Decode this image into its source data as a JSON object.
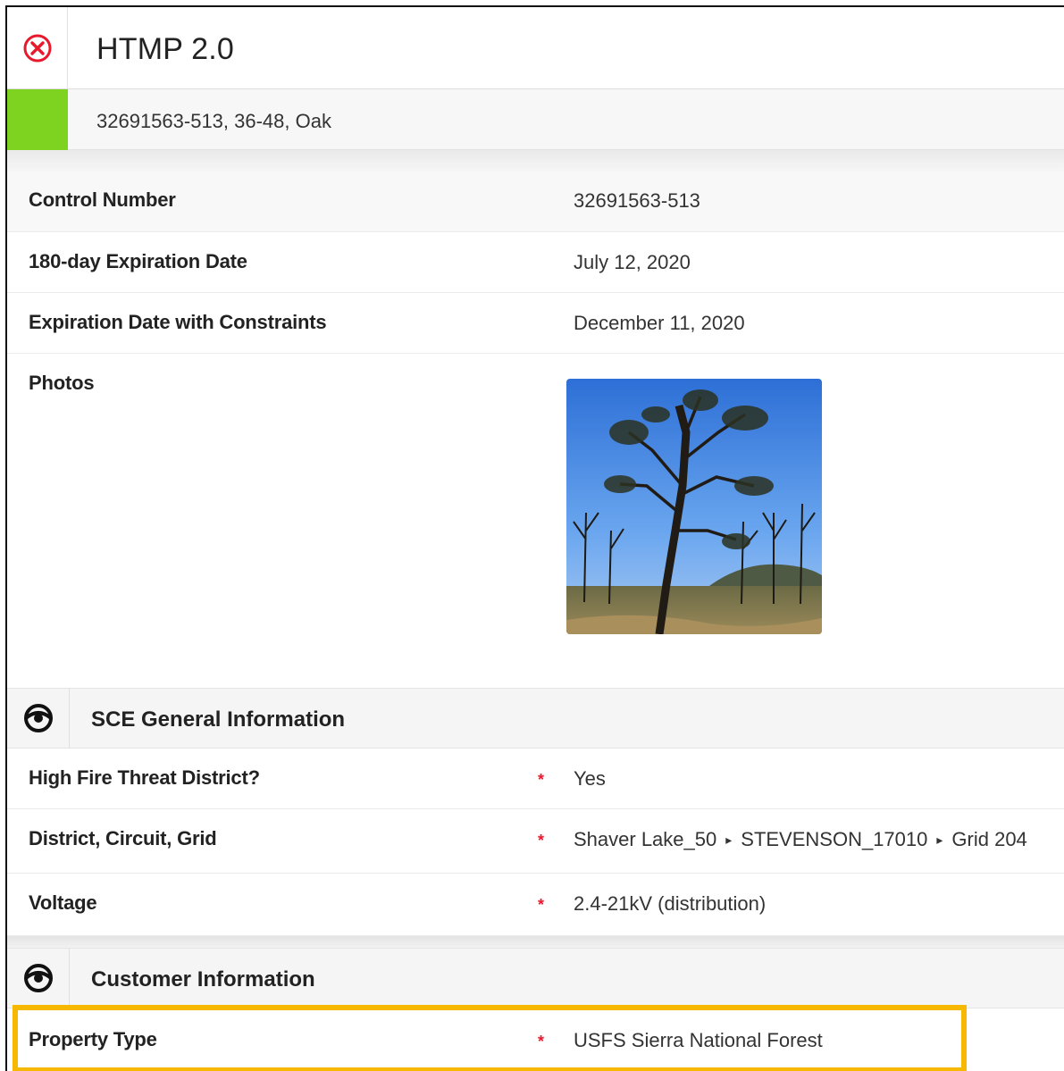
{
  "header": {
    "app_title": "HTMP 2.0",
    "close_icon": "close-circle-icon",
    "close_color": "#e8192c"
  },
  "record": {
    "title": "32691563-513, 36-48, Oak",
    "status_color": "#7ed321"
  },
  "fields": {
    "control_number": {
      "label": "Control Number",
      "value": "32691563-513"
    },
    "expiration_180": {
      "label": "180-day Expiration Date",
      "value": "July 12, 2020"
    },
    "expiration_constraints": {
      "label": "Expiration Date with Constraints",
      "value": "December 11, 2020"
    },
    "photos": {
      "label": "Photos"
    }
  },
  "sections": {
    "general": {
      "title": "SCE General Information",
      "toggle_icon": "eye-icon",
      "fields": {
        "high_fire": {
          "label": "High Fire Threat District?",
          "required": "*",
          "value": "Yes"
        },
        "district": {
          "label": "District, Circuit, Grid",
          "required": "*",
          "path": [
            "Shaver Lake_50",
            "STEVENSON_17010",
            "Grid 204"
          ],
          "separator": "▸"
        },
        "voltage": {
          "label": "Voltage",
          "required": "*",
          "value": "2.4-21kV (distribution)"
        }
      }
    },
    "customer": {
      "title": "Customer Information",
      "toggle_icon": "eye-icon",
      "fields": {
        "property_type": {
          "label": "Property Type",
          "required": "*",
          "value": "USFS Sierra National Forest"
        }
      }
    }
  },
  "colors": {
    "required_marker": "#e8192c",
    "highlight_border": "#f6b800"
  }
}
